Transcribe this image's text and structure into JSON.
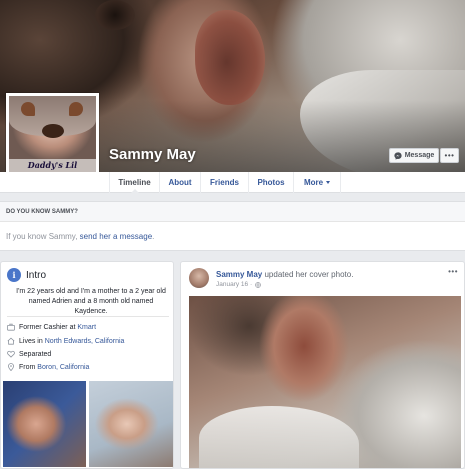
{
  "profile": {
    "name": "Sammy May",
    "picture_caption": "Daddy's Lil Monster",
    "message_label": "Message",
    "more_label": "•••"
  },
  "nav": {
    "tabs": [
      {
        "label": "Timeline"
      },
      {
        "label": "About"
      },
      {
        "label": "Friends"
      },
      {
        "label": "Photos"
      },
      {
        "label": "More"
      }
    ]
  },
  "know": {
    "heading": "DO YOU KNOW SAMMY?",
    "text_prefix": "If you know Sammy, ",
    "link": "send her a message",
    "text_suffix": "."
  },
  "intro": {
    "title": "Intro",
    "bio": "I'm 22 years old and I'm a mother to a 2 year old named Adrien and a 8 month old named Kaydence.",
    "work_prefix": "Former Cashier at ",
    "work_link": "Kmart",
    "lives_prefix": "Lives in ",
    "lives_link": "North Edwards, California",
    "relationship": "Separated",
    "from_prefix": "From ",
    "from_link": "Boron, California"
  },
  "post": {
    "author": "Sammy May",
    "action": " updated her cover photo.",
    "date": "January 16 ·",
    "more_label": "•••"
  }
}
